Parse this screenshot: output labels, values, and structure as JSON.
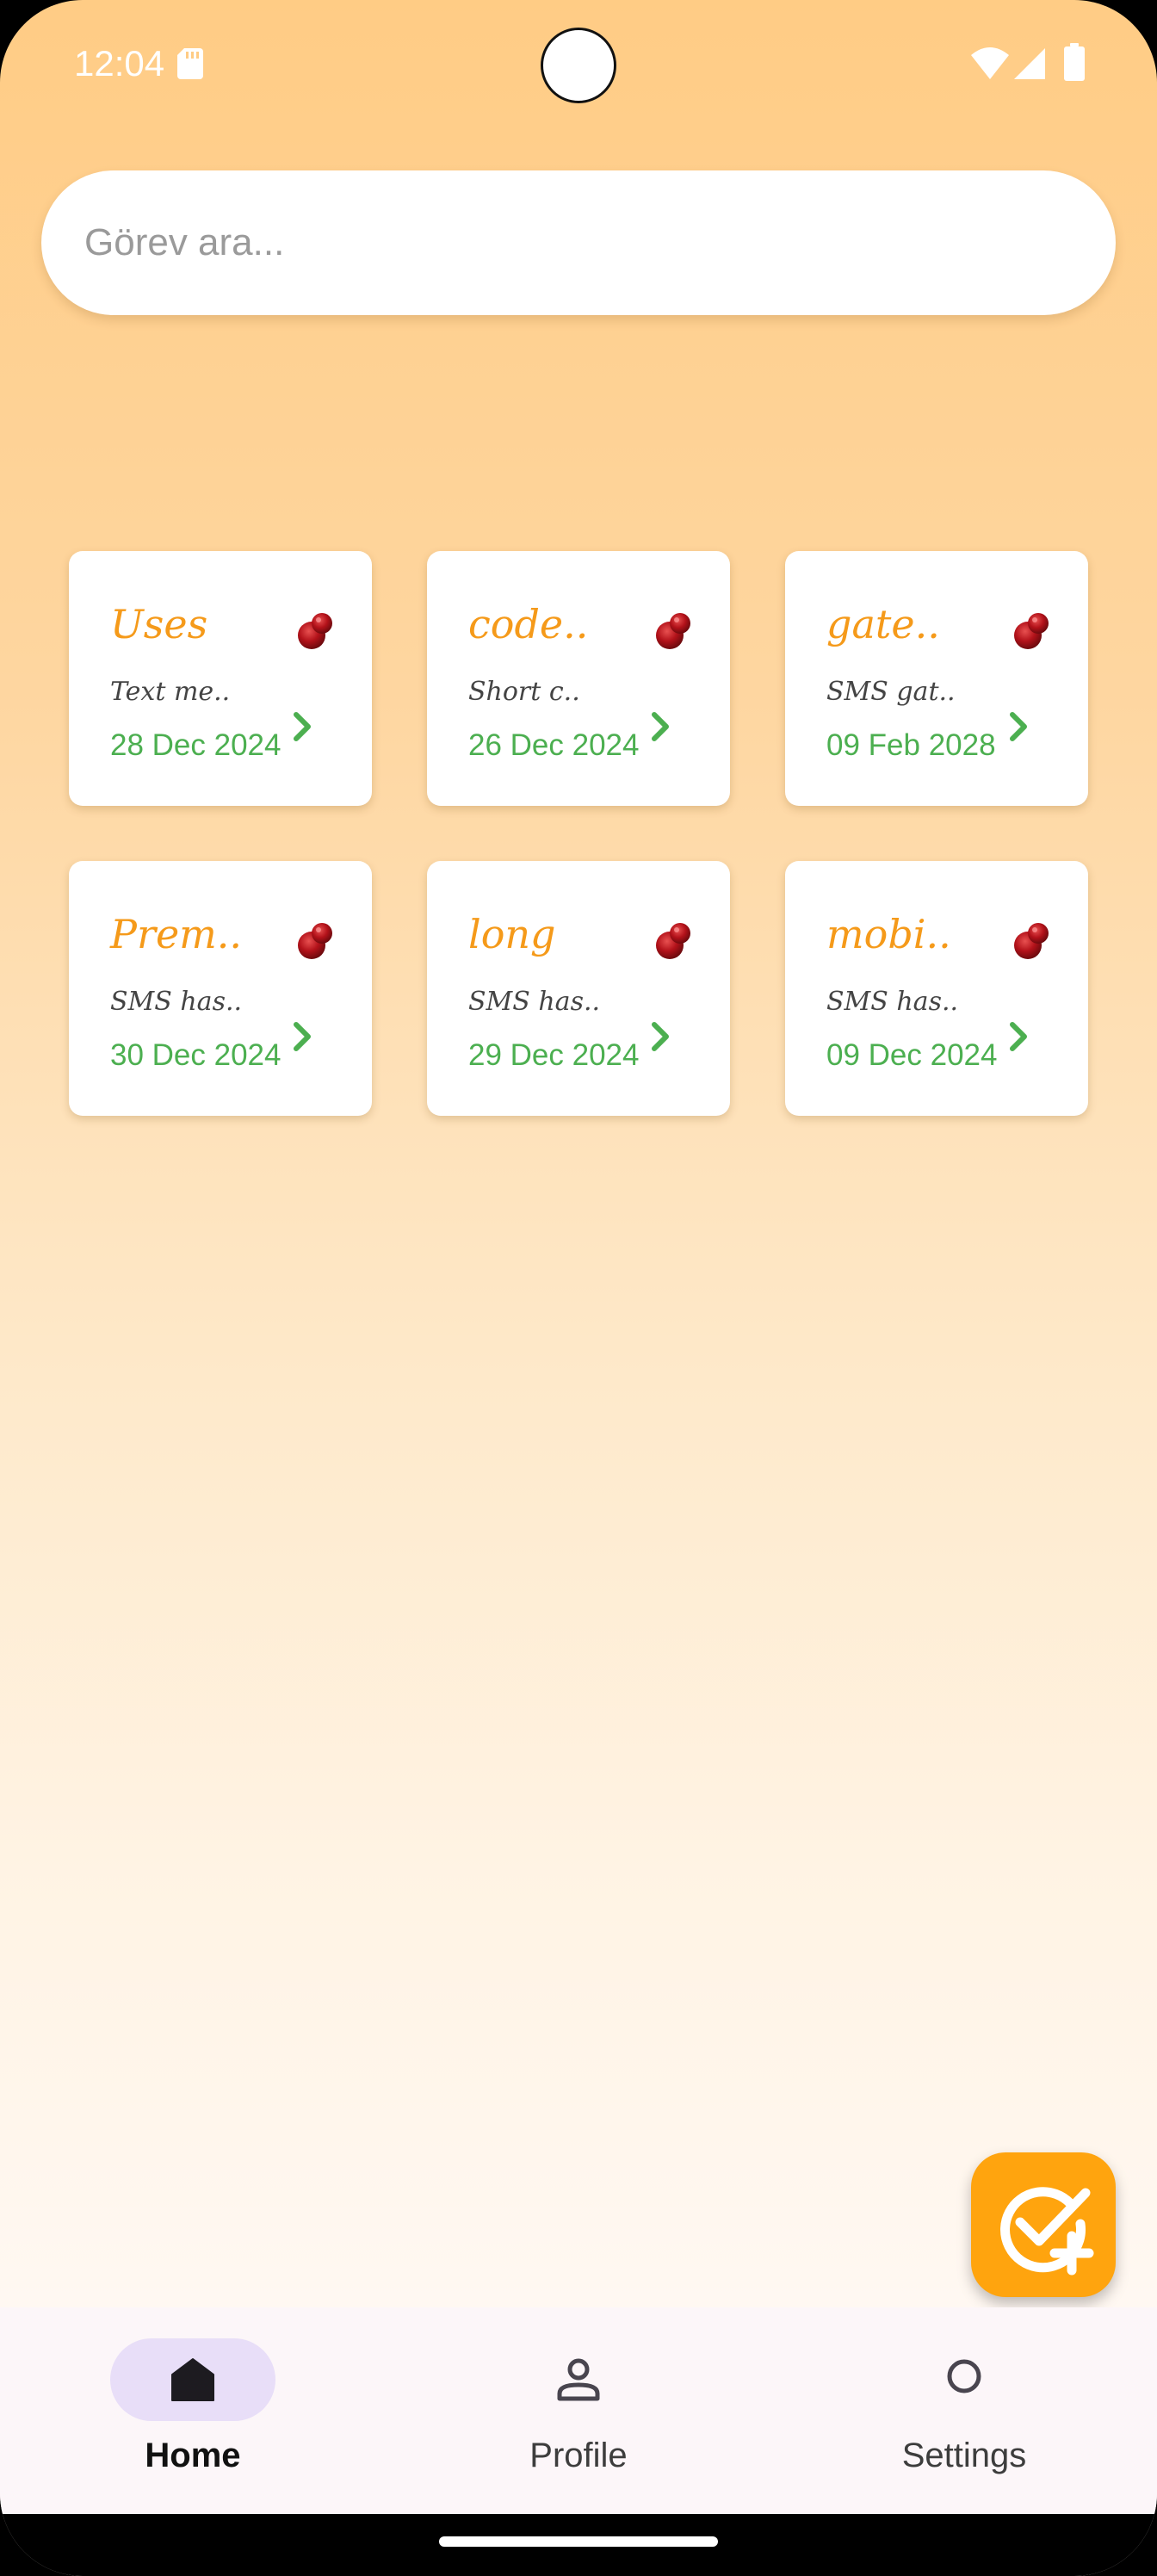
{
  "status_bar": {
    "time": "12:04"
  },
  "search": {
    "placeholder": "Görev ara..."
  },
  "tasks": [
    {
      "title": "Uses",
      "description": "Text me..",
      "date": "28 Dec 2024"
    },
    {
      "title": "code..",
      "description": "Short c..",
      "date": "26 Dec 2024"
    },
    {
      "title": "gate..",
      "description": "SMS gat..",
      "date": "09 Feb 2028"
    },
    {
      "title": "Prem..",
      "description": "SMS has..",
      "date": "30 Dec 2024"
    },
    {
      "title": "long",
      "description": "SMS has..",
      "date": "29 Dec 2024"
    },
    {
      "title": "mobi..",
      "description": "SMS has..",
      "date": "09 Dec 2024"
    }
  ],
  "bottom_nav": {
    "active": "home",
    "items": [
      {
        "label": "Home",
        "icon": "home-icon"
      },
      {
        "label": "Profile",
        "icon": "person-icon"
      },
      {
        "label": "Settings",
        "icon": "circle-icon"
      }
    ]
  },
  "colors": {
    "accent": "#FFA40E",
    "title": "#F59A1A",
    "date": "#4CAF50",
    "nav_indicator": "#E8DEF8"
  }
}
